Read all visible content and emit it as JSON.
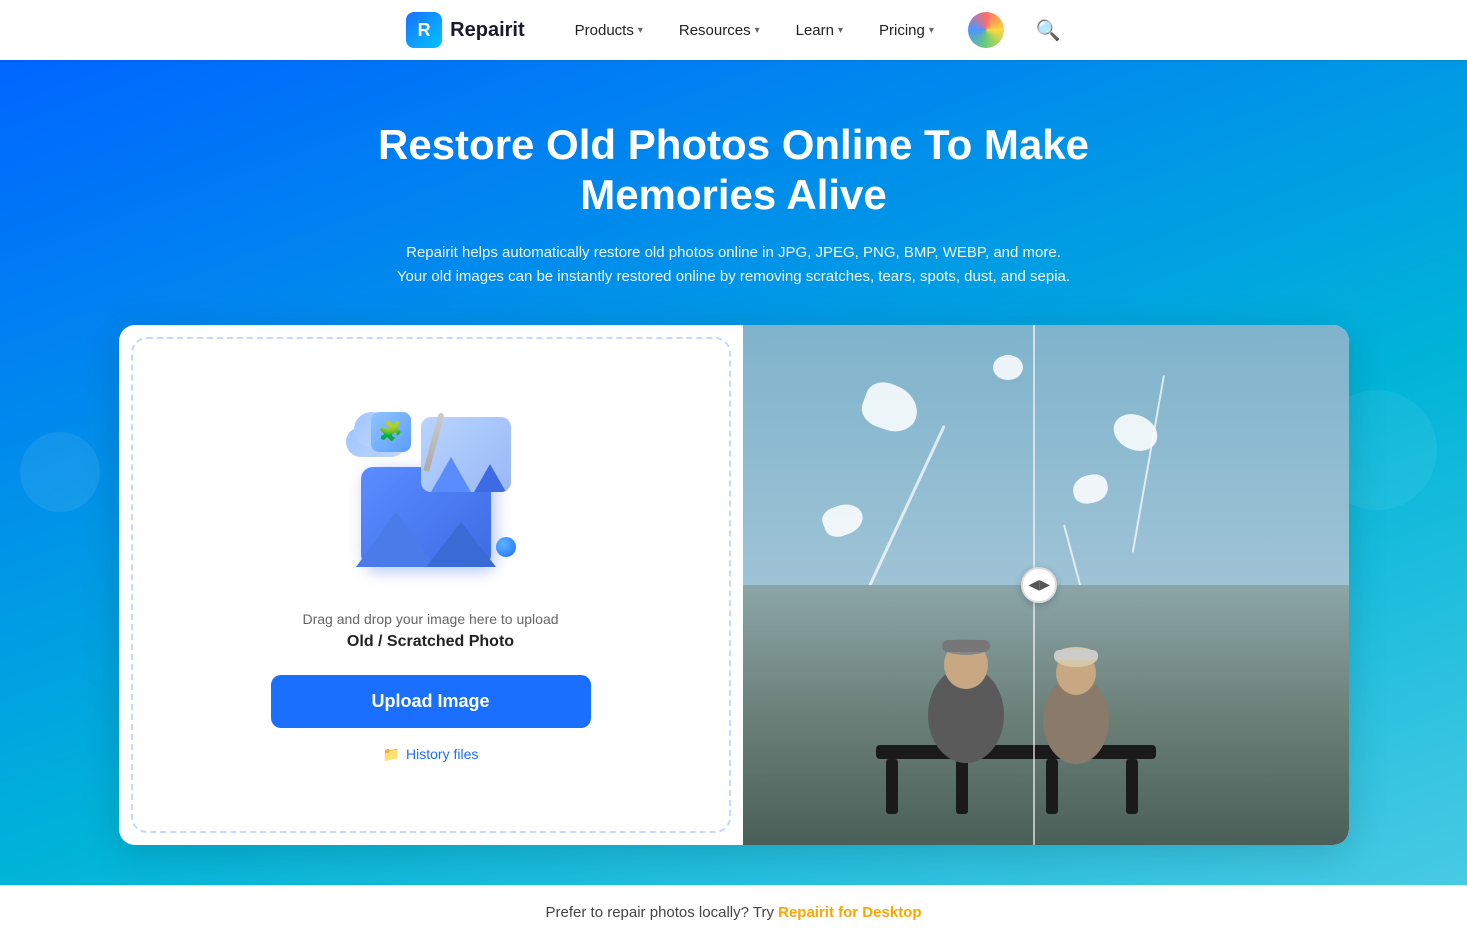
{
  "navbar": {
    "logo_text": "Repairit",
    "nav_items": [
      {
        "label": "Products",
        "has_chevron": true
      },
      {
        "label": "Resources",
        "has_chevron": true
      },
      {
        "label": "Learn",
        "has_chevron": true
      },
      {
        "label": "Pricing",
        "has_chevron": true
      }
    ],
    "search_icon": "🔍"
  },
  "hero": {
    "title": "Restore Old Photos Online To Make Memories Alive",
    "subtitle_line1": "Repairit helps automatically restore old photos online in JPG, JPEG, PNG, BMP, WEBP, and more.",
    "subtitle_line2": "Your old images can be instantly restored online by removing scratches, tears, spots, dust, and sepia."
  },
  "upload_panel": {
    "drag_text": "Drag and drop your image here to upload",
    "label": "Old / Scratched Photo",
    "button_label": "Upload Image",
    "history_label": "History files"
  },
  "bottom_bar": {
    "text": "Prefer to repair photos locally? Try",
    "link_label": "Repairit for Desktop"
  }
}
